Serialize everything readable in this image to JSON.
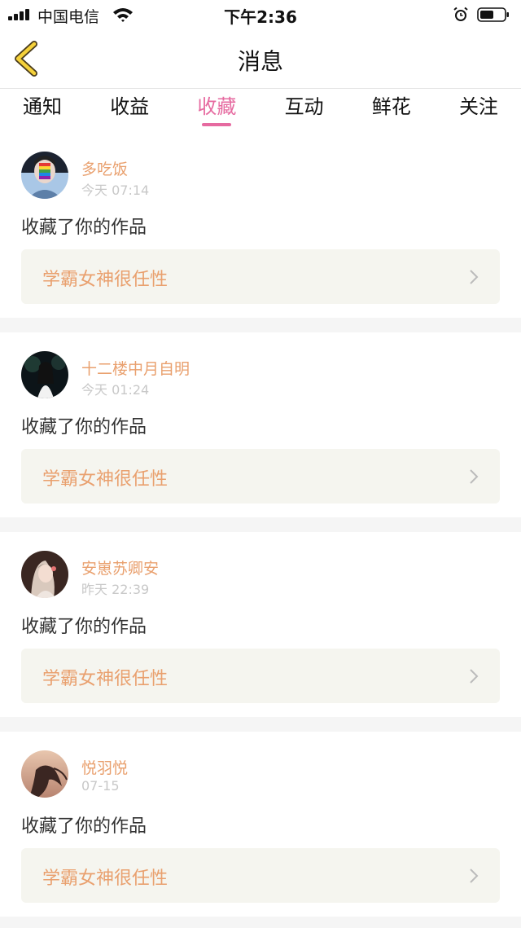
{
  "status_bar": {
    "carrier": "中国电信",
    "time": "下午2:36"
  },
  "nav": {
    "title": "消息",
    "back_icon": "chevron-left-icon"
  },
  "tabs": [
    {
      "label": "通知",
      "active": false
    },
    {
      "label": "收益",
      "active": false
    },
    {
      "label": "收藏",
      "active": true
    },
    {
      "label": "互动",
      "active": false
    },
    {
      "label": "鲜花",
      "active": false
    },
    {
      "label": "关注",
      "active": false
    }
  ],
  "colors": {
    "accent_pink": "#e66aa0",
    "name_orange": "#e9a06e",
    "box_bg": "#f5f5ef"
  },
  "messages": [
    {
      "name": "多吃饭",
      "time": "今天 07:14",
      "action": "收藏了你的作品",
      "work": "学霸女神很任性"
    },
    {
      "name": "十二楼中月自明",
      "time": "今天 01:24",
      "action": "收藏了你的作品",
      "work": "学霸女神很任性"
    },
    {
      "name": "安崽苏卿安",
      "time": "昨天 22:39",
      "action": "收藏了你的作品",
      "work": "学霸女神很任性"
    },
    {
      "name": "悦羽悦",
      "time": "07-15",
      "action": "收藏了你的作品",
      "work": "学霸女神很任性"
    }
  ]
}
